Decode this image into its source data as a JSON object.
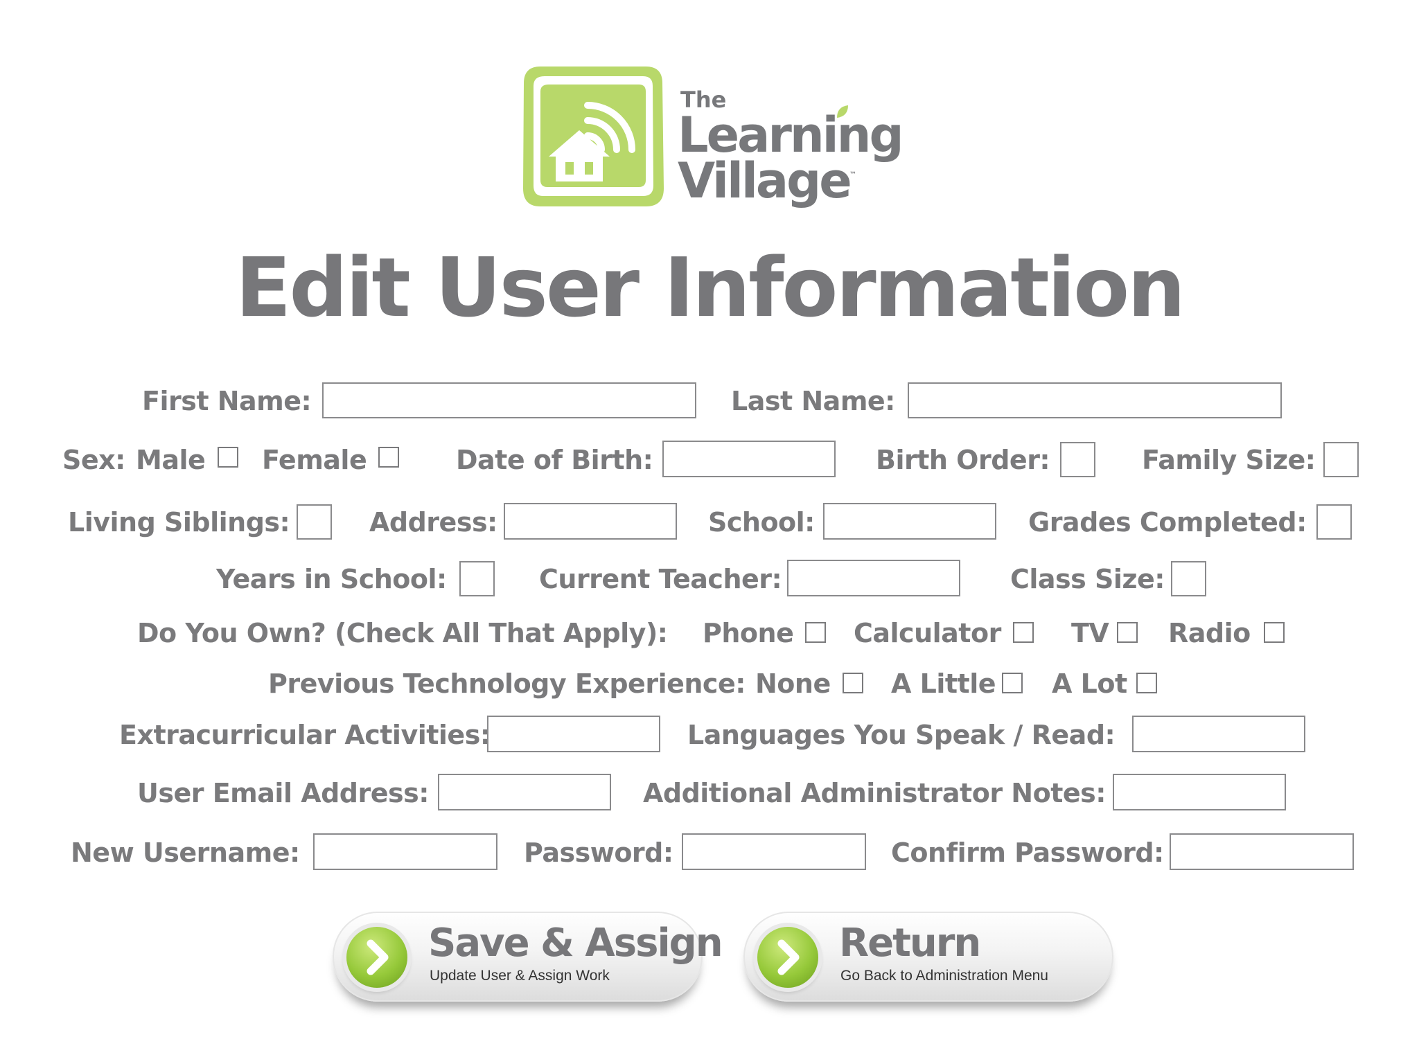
{
  "brand": {
    "logo_lines": [
      "The",
      "Learning",
      "Village"
    ],
    "trademark": "™",
    "colors": {
      "accent_green": "#b7d869",
      "text_gray": "#77787b"
    },
    "icon": "house-with-signal-icon"
  },
  "title": "Edit User Information",
  "form": {
    "first_name": {
      "label": "First Name:",
      "value": ""
    },
    "last_name": {
      "label": "Last Name:",
      "value": ""
    },
    "sex": {
      "label": "Sex:",
      "male_label": "Male",
      "female_label": "Female",
      "male_checked": false,
      "female_checked": false
    },
    "date_of_birth": {
      "label": "Date of Birth:",
      "value": ""
    },
    "birth_order": {
      "label": "Birth Order:",
      "value": ""
    },
    "family_size": {
      "label": "Family Size:",
      "value": ""
    },
    "living_siblings": {
      "label": "Living Siblings:",
      "value": ""
    },
    "address": {
      "label": "Address:",
      "value": ""
    },
    "school": {
      "label": "School:",
      "value": ""
    },
    "grades_completed": {
      "label": "Grades Completed:",
      "value": ""
    },
    "years_in_school": {
      "label": "Years in School:",
      "value": ""
    },
    "current_teacher": {
      "label": "Current Teacher:",
      "value": ""
    },
    "class_size": {
      "label": "Class Size:",
      "value": ""
    },
    "own": {
      "label": "Do You Own? (Check All That Apply):",
      "phone": "Phone",
      "calculator": "Calculator",
      "tv": "TV",
      "radio": "Radio"
    },
    "tech_experience": {
      "label": "Previous Technology Experience:",
      "none": "None",
      "a_little": "A Little",
      "a_lot": "A Lot"
    },
    "extracurricular": {
      "label": "Extracurricular Activities:",
      "value": ""
    },
    "languages": {
      "label": "Languages You Speak / Read:",
      "value": ""
    },
    "email": {
      "label": "User Email Address:",
      "value": ""
    },
    "admin_notes": {
      "label": "Additional Administrator Notes:",
      "value": ""
    },
    "username": {
      "label": "New Username:",
      "value": ""
    },
    "password": {
      "label": "Password:",
      "value": ""
    },
    "confirm_password": {
      "label": "Confirm Password:",
      "value": ""
    }
  },
  "buttons": {
    "save": {
      "label": "Save & Assign",
      "sublabel": "Update User & Assign Work",
      "icon": "chevron-right-icon"
    },
    "return": {
      "label": "Return",
      "sublabel": "Go Back to Administration Menu",
      "icon": "chevron-right-icon"
    }
  }
}
